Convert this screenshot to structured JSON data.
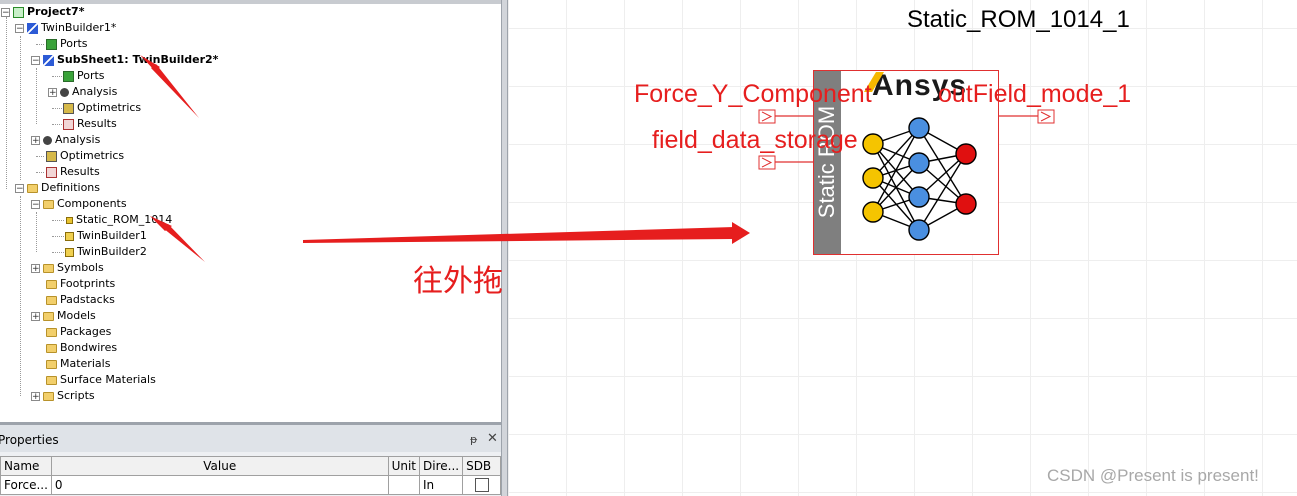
{
  "tree": {
    "project": "Project7*",
    "design": "TwinBuilder1*",
    "ports": "Ports",
    "subsheet": "SubSheet1: TwinBuilder2*",
    "sub_ports": "Ports",
    "sub_analysis": "Analysis",
    "sub_optimetrics": "Optimetrics",
    "sub_results": "Results",
    "analysis": "Analysis",
    "optimetrics": "Optimetrics",
    "results": "Results",
    "definitions": "Definitions",
    "components": "Components",
    "comp_static_rom": "Static_ROM_1014",
    "comp_twinbuilder1": "TwinBuilder1",
    "comp_twinbuilder2": "TwinBuilder2",
    "symbols": "Symbols",
    "footprints": "Footprints",
    "padstacks": "Padstacks",
    "models": "Models",
    "packages": "Packages",
    "bondwires": "Bondwires",
    "materials": "Materials",
    "surface_materials": "Surface Materials",
    "scripts": "Scripts"
  },
  "properties": {
    "title": "Properties",
    "pin_glyph": "ᵽ",
    "close_glyph": "✕",
    "columns": [
      "Name",
      "Value",
      "Unit",
      "Dire...",
      "SDB"
    ],
    "row": {
      "name": "Force...",
      "value": "0",
      "unit": "",
      "direction": "In"
    }
  },
  "schematic": {
    "component_title": "Static_ROM_1014_1",
    "pin_force": "Force_Y_Component",
    "pin_field": "field_data_storage",
    "pin_out": "outField_mode_1",
    "block_label": "Static ROM",
    "logo": "Ansys"
  },
  "annotation": {
    "note": "往外拖"
  },
  "watermark": "CSDN @Present is present!",
  "colors": {
    "annotation_red": "#e61e1e",
    "input_node": "#f5c400",
    "hidden_node": "#4a8fe0",
    "output_node": "#e01010"
  }
}
